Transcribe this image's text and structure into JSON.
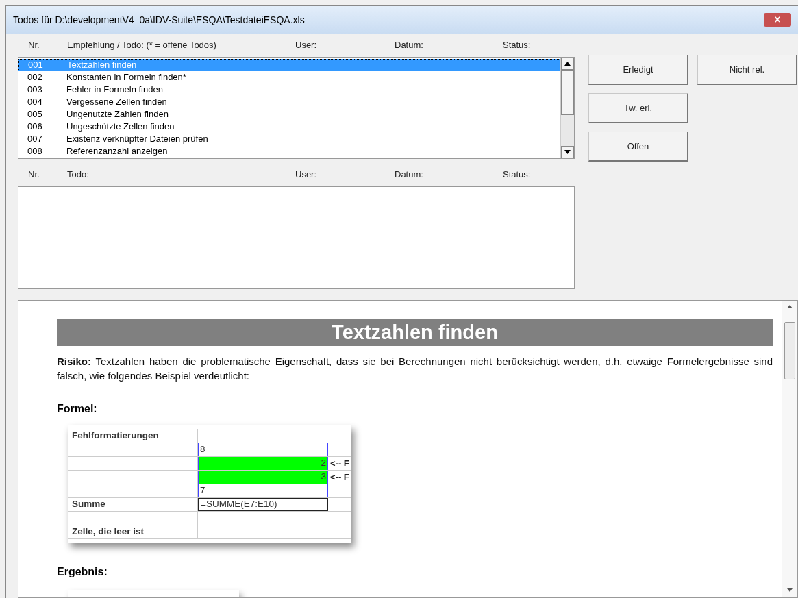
{
  "window": {
    "title": "Todos für D:\\developmentV4_0a\\IDV-Suite\\ESQA\\TestdateiESQA.xls",
    "close": "×"
  },
  "recommendations": {
    "columns": [
      "Nr.",
      "Empfehlung / Todo: (* = offene Todos)",
      "User:",
      "Datum:",
      "Status:"
    ],
    "rows": [
      {
        "nr": "001",
        "text": "Textzahlen finden",
        "selected": true
      },
      {
        "nr": "002",
        "text": "Konstanten in Formeln finden*",
        "selected": false
      },
      {
        "nr": "003",
        "text": "Fehler in Formeln finden",
        "selected": false
      },
      {
        "nr": "004",
        "text": "Vergessene Zellen finden",
        "selected": false
      },
      {
        "nr": "005",
        "text": "Ungenutzte Zahlen finden",
        "selected": false
      },
      {
        "nr": "006",
        "text": "Ungeschützte Zellen finden",
        "selected": false
      },
      {
        "nr": "007",
        "text": "Existenz verknüpfter Dateien prüfen",
        "selected": false
      },
      {
        "nr": "008",
        "text": "Referenzanzahl anzeigen",
        "selected": false
      }
    ]
  },
  "todos": {
    "columns": [
      "Nr.",
      "Todo:",
      "User:",
      "Datum:",
      "Status:"
    ]
  },
  "buttons": [
    [
      "Erledigt",
      "Nicht rel."
    ],
    [
      "Tw. erl."
    ],
    [
      "Offen"
    ]
  ],
  "help": {
    "heading": "Textzahlen finden",
    "paragraph": "**Risiko:** Textzahlen haben die problematische Eigenschaft, dass sie bei Berechnungen nicht berücksichtigt werden, d.h. etwaige Formelergebnisse sind falsch, wie folgendes Beispiel verdeutlicht:",
    "formula_label": "Formel:",
    "sheet_rows": [
      {
        "label": "Fehlformatierungen",
        "value": "",
        "kind": "plain",
        "note": ""
      },
      {
        "label": "",
        "value": "8",
        "kind": "left",
        "note": ""
      },
      {
        "label": "",
        "value": "2",
        "kind": "green",
        "note": "<-- F"
      },
      {
        "label": "",
        "value": "3",
        "kind": "green",
        "note": "<-- F"
      },
      {
        "label": "",
        "value": "7",
        "kind": "left",
        "note": ""
      },
      {
        "label": "Summe",
        "value": "=SUMME(E7:E10)",
        "kind": "formula",
        "note": ""
      },
      {
        "label": "",
        "value": "",
        "kind": "plain",
        "note": ""
      },
      {
        "label": "Zelle, die leer ist",
        "value": "",
        "kind": "plain",
        "note": ""
      }
    ],
    "result_label": "Ergebnis:"
  }
}
